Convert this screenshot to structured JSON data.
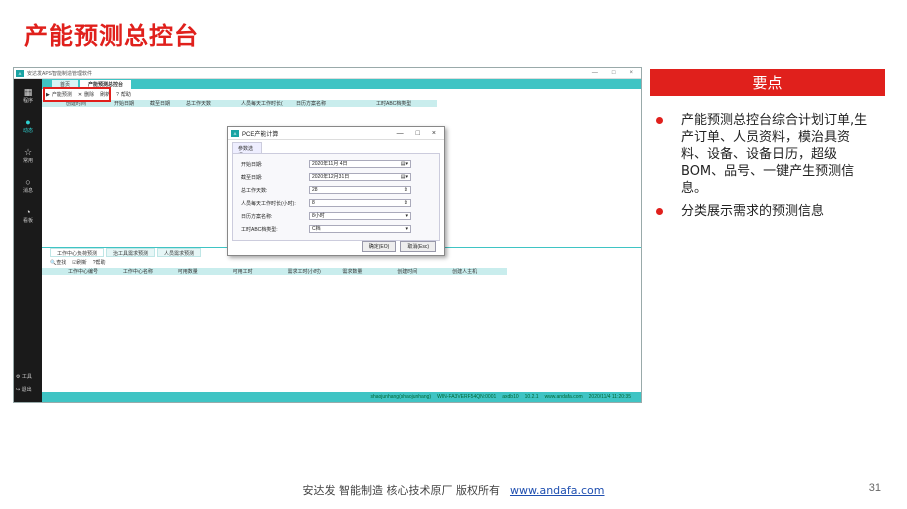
{
  "slide": {
    "title": "产能预测总控台",
    "page_number": "31"
  },
  "app": {
    "window_title": "安达发APS智能制造管理软件",
    "window_controls": [
      "—",
      "□",
      "×"
    ],
    "nav": [
      {
        "icon": "apps-icon",
        "label": "程序"
      },
      {
        "icon": "clock-icon",
        "label": "动态"
      },
      {
        "icon": "star-icon",
        "label": "常用"
      },
      {
        "icon": "chat-icon",
        "label": "消息"
      },
      {
        "icon": "dashboard-icon",
        "label": "看板"
      }
    ],
    "nav_bottom": [
      "工具",
      "退出"
    ],
    "tabs": [
      "首页",
      "产能预测总控台"
    ],
    "toolbar": [
      "产能预测",
      "删除",
      "刷新",
      "帮助"
    ],
    "grid_columns": [
      "创建时间",
      "开始日期",
      "截至日期",
      "总工作天数",
      "人员每天工作时长(",
      "日历方案名称",
      "工时ABC档类型"
    ],
    "bottom_tabs": [
      "工作中心负荷预测",
      "治工具需求预测",
      "人员需求预测"
    ],
    "toolbar2": [
      "查找",
      "刷新",
      "帮助"
    ],
    "grid2_columns": [
      "工作中心编号",
      "工作中心名称",
      "可用数量",
      "可用工时",
      "需求工时(小时)",
      "需求数量",
      "创建时间",
      "创建人主机"
    ],
    "status": {
      "user": "shaojunhang(shaojunhang)",
      "host": "WIN-FA3VERF54QN:0001",
      "db": "axdb10",
      "ip": "10.2.1",
      "site": "www.andafa.com",
      "time": "2020/11/4 11:20:35"
    }
  },
  "dialog": {
    "title": "PCE产能计算",
    "controls": [
      "—",
      "□",
      "×"
    ],
    "tab": "参数选择",
    "fields": [
      {
        "label": "开始日期:",
        "value": "2020年11月 4日"
      },
      {
        "label": "截至日期:",
        "value": "2020年12月31日"
      },
      {
        "label": "总工作天数:",
        "value": "28"
      },
      {
        "label": "人员每天工作时长(小时):",
        "value": "8"
      },
      {
        "label": "日历方案名称:",
        "value": "8小时"
      },
      {
        "label": "工时ABC档类型:",
        "value": "C档"
      }
    ],
    "ok": "确定(EO)",
    "cancel": "取消(Esc)"
  },
  "keypoints": {
    "header": "要点",
    "items": [
      "产能预测总控台综合计划订单,生产订单、人员资料，模治具资料、设备、设备日历，超级BOM、品号、一键产生预测信息。",
      "分类展示需求的预测信息"
    ]
  },
  "footer": {
    "text": "安达发  智能制造 核心技术原厂   版权所有",
    "link": "www.andafa.com"
  },
  "colors": {
    "accent": "#e0201c",
    "teal": "#3fc4c4"
  }
}
